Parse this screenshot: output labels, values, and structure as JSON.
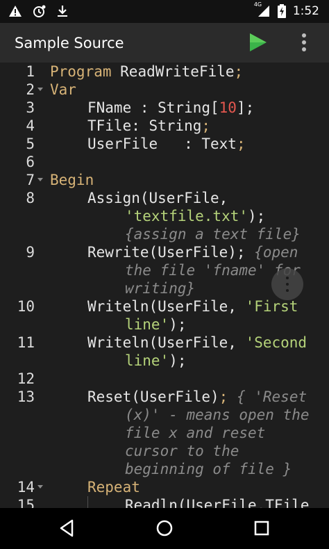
{
  "status_bar": {
    "time": "1:52",
    "network": "4G",
    "icons": [
      "warning-icon",
      "alarm-icon",
      "download-icon",
      "signal-icon",
      "battery-charging-icon"
    ]
  },
  "app_bar": {
    "title": "Sample Source",
    "actions": [
      "play-icon",
      "more-vert-icon"
    ]
  },
  "colors": {
    "keyword": "#d7b377",
    "string": "#b5d37a",
    "number": "#e4574f",
    "comment": "#8b8b8b",
    "text": "#e6e6e6",
    "run_button": "#3bb34a"
  },
  "editor": {
    "lines": [
      {
        "n": "1",
        "t1": "Program",
        "t2": " ReadWriteFile",
        "t3": ";"
      },
      {
        "n": "2",
        "t1": "Var"
      },
      {
        "n": "3",
        "t1": "FName : String[",
        "t2": "10",
        "t3": "];"
      },
      {
        "n": "4",
        "t1": "TFile: String",
        "t2": ";"
      },
      {
        "n": "5",
        "t1": "UserFile   : Text",
        "t2": ";"
      },
      {
        "n": "6"
      },
      {
        "n": "7",
        "t1": "Begin"
      },
      {
        "n": "8",
        "t1": "Assign(UserFile,",
        "t2": "'textfile.txt'",
        "t3": ");",
        "c1": "{assign a text file}"
      },
      {
        "n": "9",
        "t1": "Rewrite(UserFile);",
        "c1": " {open",
        "c2": "the file 'fname' for",
        "c3": "writing}"
      },
      {
        "n": "10",
        "t1": "Writeln(UserFile, ",
        "t2": "'First",
        "t3": "line'",
        "t4": ");"
      },
      {
        "n": "11",
        "t1": "Writeln(UserFile, ",
        "t2": "'Second",
        "t3": "line'",
        "t4": ");"
      },
      {
        "n": "12"
      },
      {
        "n": "13",
        "t1": "Reset(UserFile)",
        "t2": ";",
        "c1": " { 'Reset",
        "c2": "(x)' - means open the",
        "c3": "file x and reset",
        "c4": "cursor to the",
        "c5": "beginning of file }"
      },
      {
        "n": "14",
        "t1": "Repeat"
      },
      {
        "n": "15",
        "t1": "Readln(UserFile,TFile"
      }
    ]
  },
  "nav_bar": {
    "buttons": [
      "back-icon",
      "home-icon",
      "recents-icon"
    ]
  }
}
